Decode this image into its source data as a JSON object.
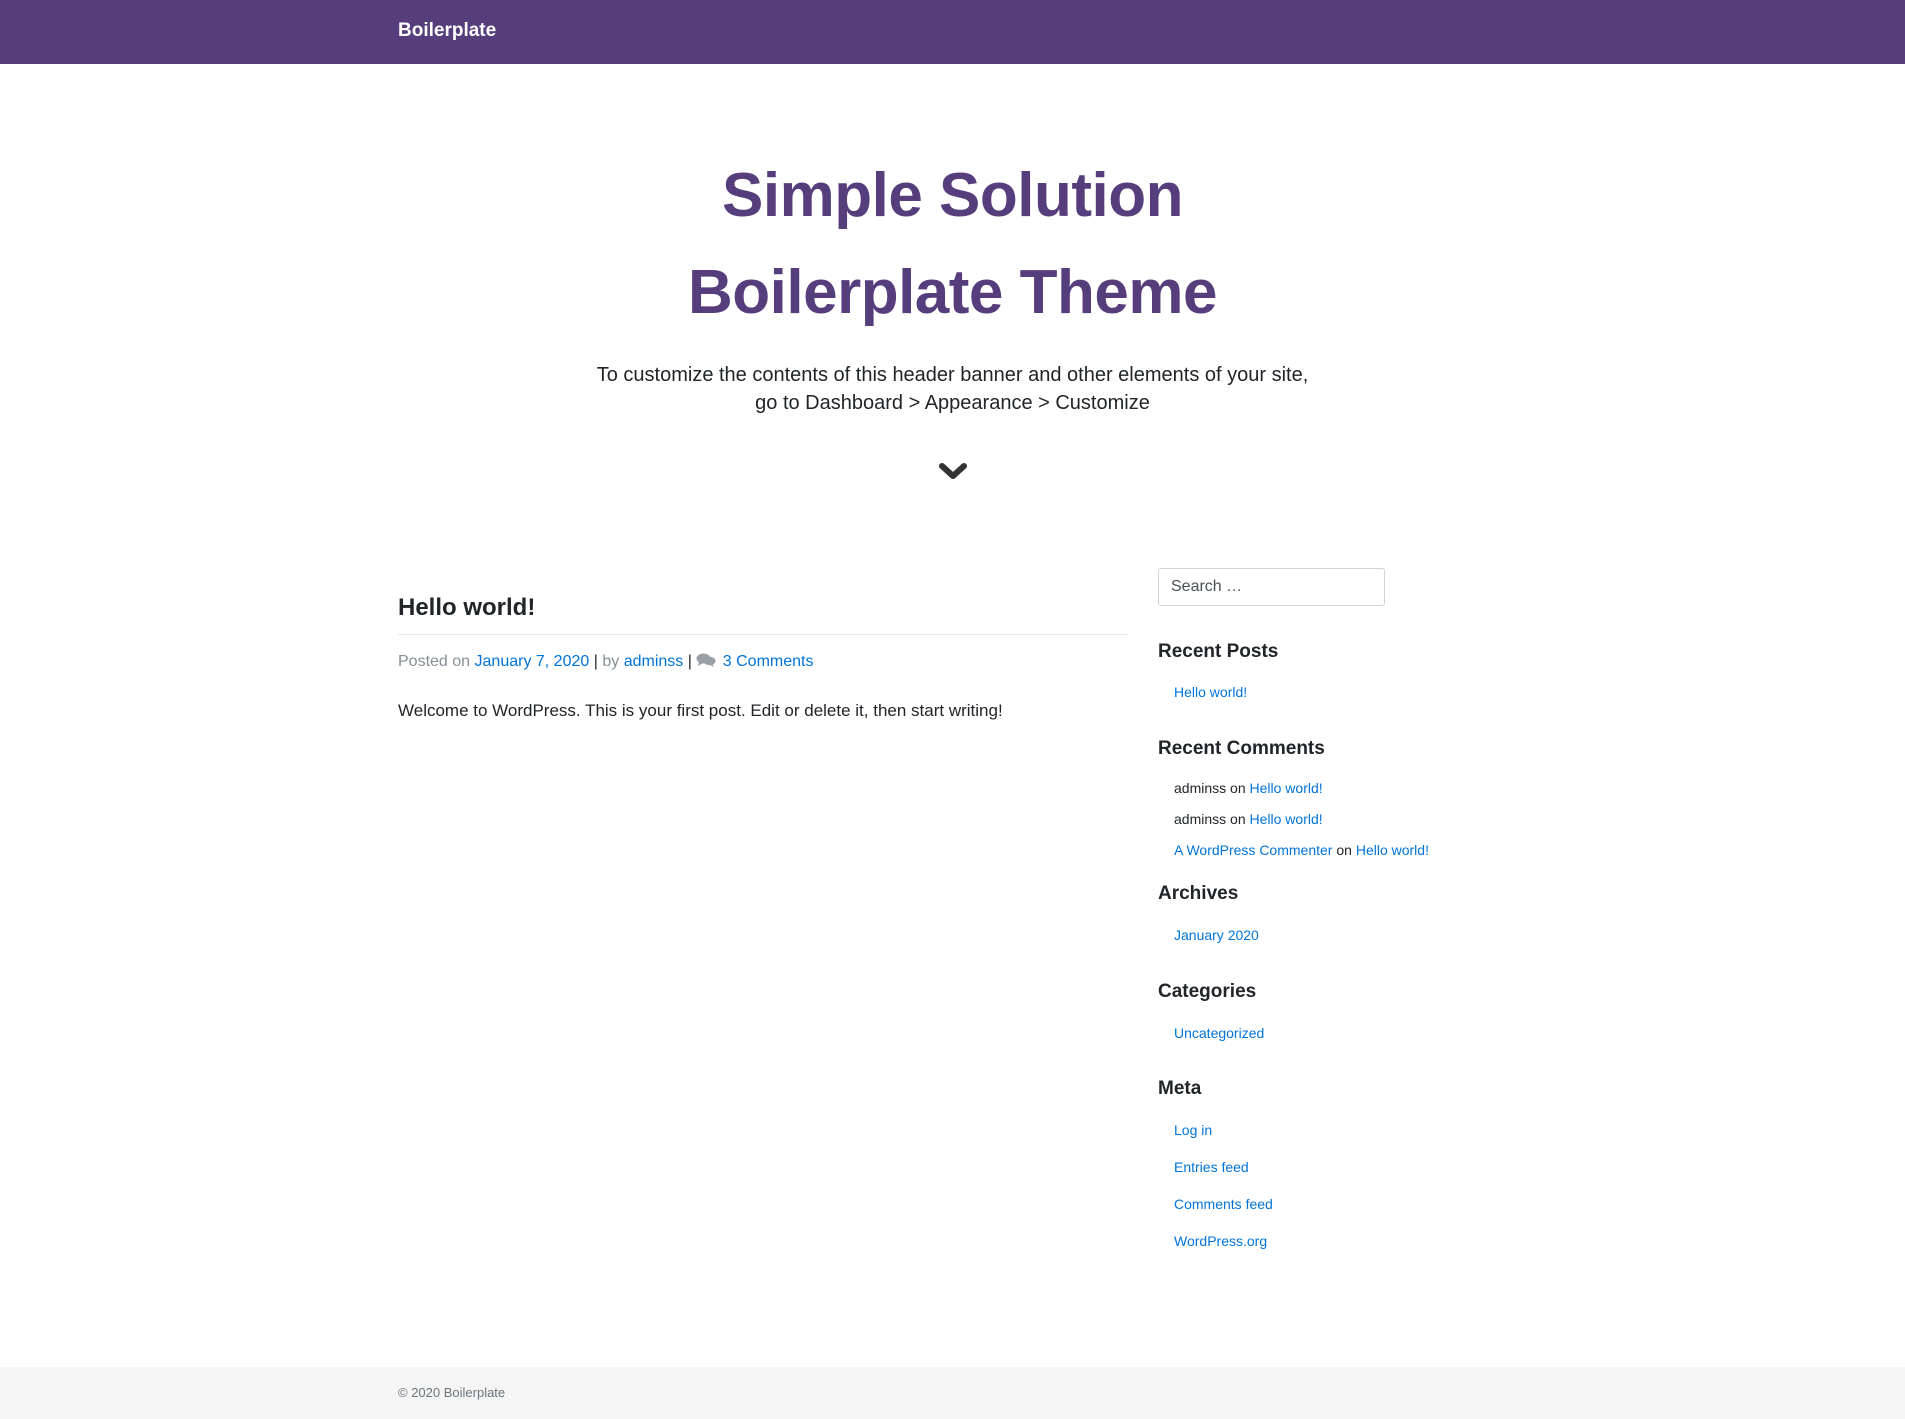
{
  "navbar": {
    "brand": "Boilerplate",
    "bg_color": "#563d7c"
  },
  "hero": {
    "title_line1": "Simple Solution",
    "title_line2": "Boilerplate Theme",
    "subtitle_line1": "To customize the contents of this header banner and other elements of your site,",
    "subtitle_line2": "go to Dashboard > Appearance > Customize",
    "scroll_icon": "chevron-down-icon",
    "title_color": "#563d7c"
  },
  "post": {
    "title": "Hello world!",
    "posted_on": "Posted on",
    "date": "January 7, 2020",
    "by": "by",
    "sep": "|",
    "author": "adminss",
    "comments_icon": "comments-icon",
    "comments": "3 Comments",
    "content": "Welcome to WordPress. This is your first post. Edit or delete it, then start writing!"
  },
  "sidebar": {
    "search_placeholder": "Search …",
    "recent_posts": {
      "title": "Recent Posts",
      "items": [
        "Hello world!"
      ]
    },
    "recent_comments": {
      "title": "Recent Comments",
      "on": "on",
      "items": [
        {
          "author": "adminss",
          "post": "Hello world!"
        },
        {
          "author": "adminss",
          "post": "Hello world!"
        },
        {
          "author": "A WordPress Commenter",
          "post": "Hello world!"
        }
      ]
    },
    "archives": {
      "title": "Archives",
      "items": [
        "January 2020"
      ]
    },
    "categories": {
      "title": "Categories",
      "items": [
        "Uncategorized"
      ]
    },
    "meta": {
      "title": "Meta",
      "items": [
        "Log in",
        "Entries feed",
        "Comments feed",
        "WordPress.org"
      ]
    }
  },
  "footer": {
    "text": "© 2020 Boilerplate"
  },
  "colors": {
    "link": "#0074d9",
    "footer_bg": "#f5f5f5"
  }
}
